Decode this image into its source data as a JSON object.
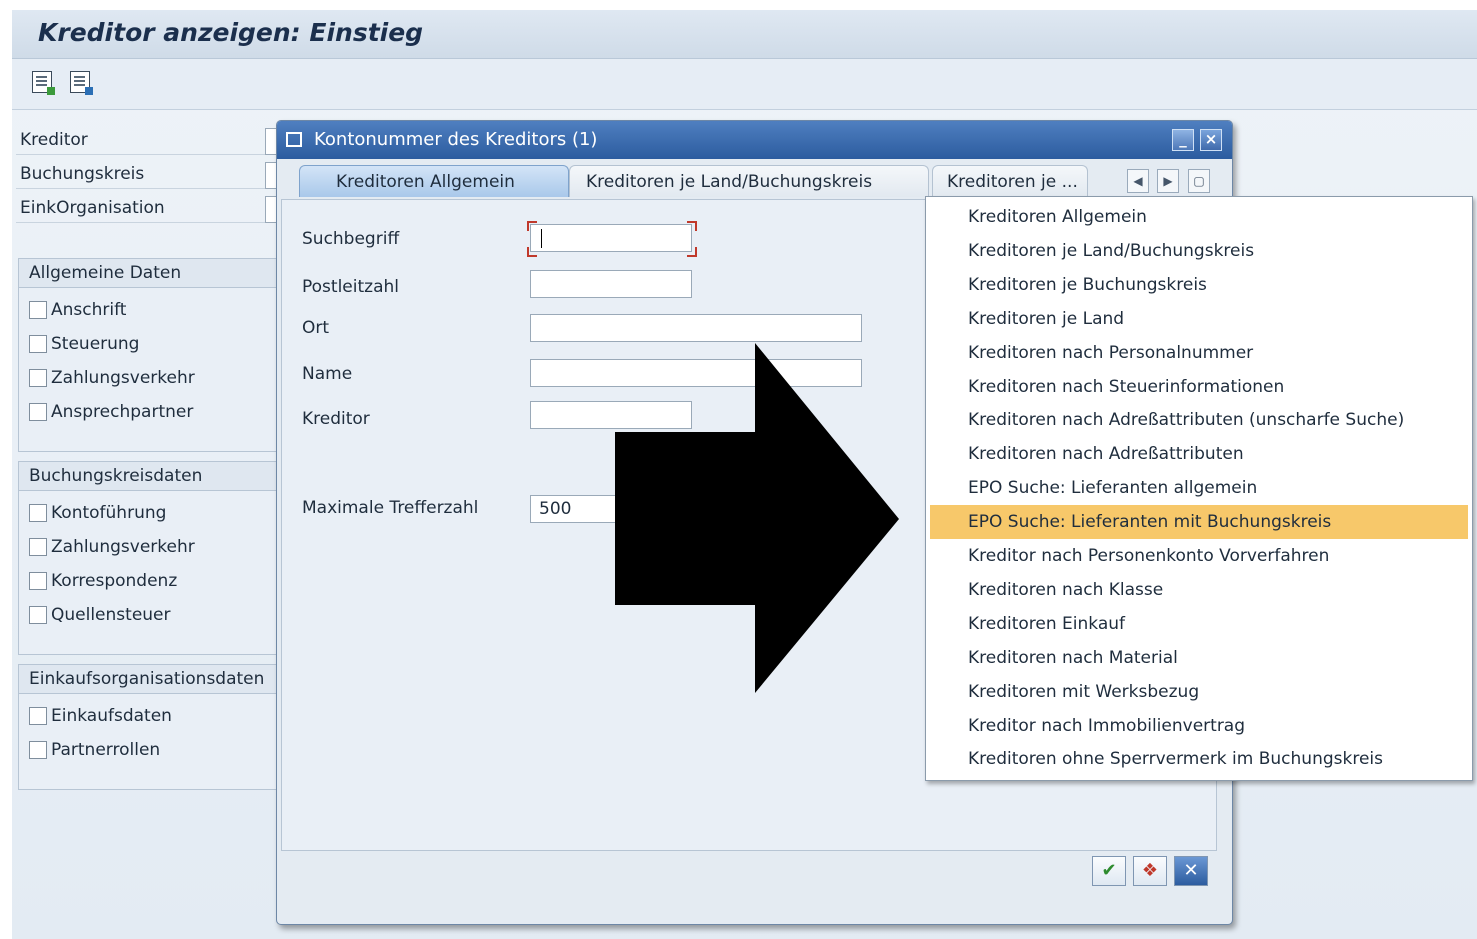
{
  "app": {
    "title": "Kreditor anzeigen: Einstieg"
  },
  "toolbar": {
    "icons": [
      "overview-icon",
      "detail-icon"
    ]
  },
  "fields": [
    {
      "label": "Kreditor"
    },
    {
      "label": "Buchungskreis"
    },
    {
      "label": "EinkOrganisation"
    }
  ],
  "groups": {
    "allgemein": {
      "title": "Allgemeine Daten",
      "items": [
        "Anschrift",
        "Steuerung",
        "Zahlungsverkehr",
        "Ansprechpartner"
      ]
    },
    "buchungskreis": {
      "title": "Buchungskreisdaten",
      "items": [
        "Kontoführung",
        "Zahlungsverkehr",
        "Korrespondenz",
        "Quellensteuer"
      ]
    },
    "einkauf": {
      "title": "Einkaufsorganisationsdaten",
      "items": [
        "Einkaufsdaten",
        "Partnerrollen"
      ]
    }
  },
  "dialog": {
    "title": "Kontonummer des Kreditors (1)",
    "tabs": [
      "Kreditoren Allgemein",
      "Kreditoren je Land/Buchungskreis",
      "Kreditoren je ..."
    ],
    "active_tab": 0,
    "form": {
      "suchbegriff": {
        "label": "Suchbegriff",
        "value": ""
      },
      "postleitzahl": {
        "label": "Postleitzahl",
        "value": ""
      },
      "ort": {
        "label": "Ort",
        "value": ""
      },
      "name": {
        "label": "Name",
        "value": ""
      },
      "kreditor": {
        "label": "Kreditor",
        "value": ""
      },
      "max_treffer": {
        "label": "Maximale Trefferzahl",
        "value": "500"
      }
    },
    "buttons": {
      "ok": "✔",
      "search": "❖",
      "cancel": "✕"
    }
  },
  "dropdown": {
    "selected_index": 9,
    "items": [
      "Kreditoren Allgemein",
      "Kreditoren je Land/Buchungskreis",
      "Kreditoren je Buchungskreis",
      "Kreditoren je Land",
      "Kreditoren nach Personalnummer",
      "Kreditoren nach Steuerinformationen",
      "Kreditoren nach Adreßattributen (unscharfe Suche)",
      "Kreditoren nach Adreßattributen",
      "EPO Suche: Lieferanten allgemein",
      "EPO Suche: Lieferanten mit Buchungskreis",
      "Kreditor nach Personenkonto Vorverfahren",
      "Kreditoren nach Klasse",
      "Kreditoren Einkauf",
      "Kreditoren nach Material",
      "Kreditoren mit Werksbezug",
      "Kreditor nach Immobilienvertrag",
      "Kreditoren ohne Sperrvermerk im Buchungskreis"
    ]
  },
  "colors": {
    "selection": "#f7c86a",
    "title_bar": "#2c5c9f",
    "arrow": "#000000"
  }
}
